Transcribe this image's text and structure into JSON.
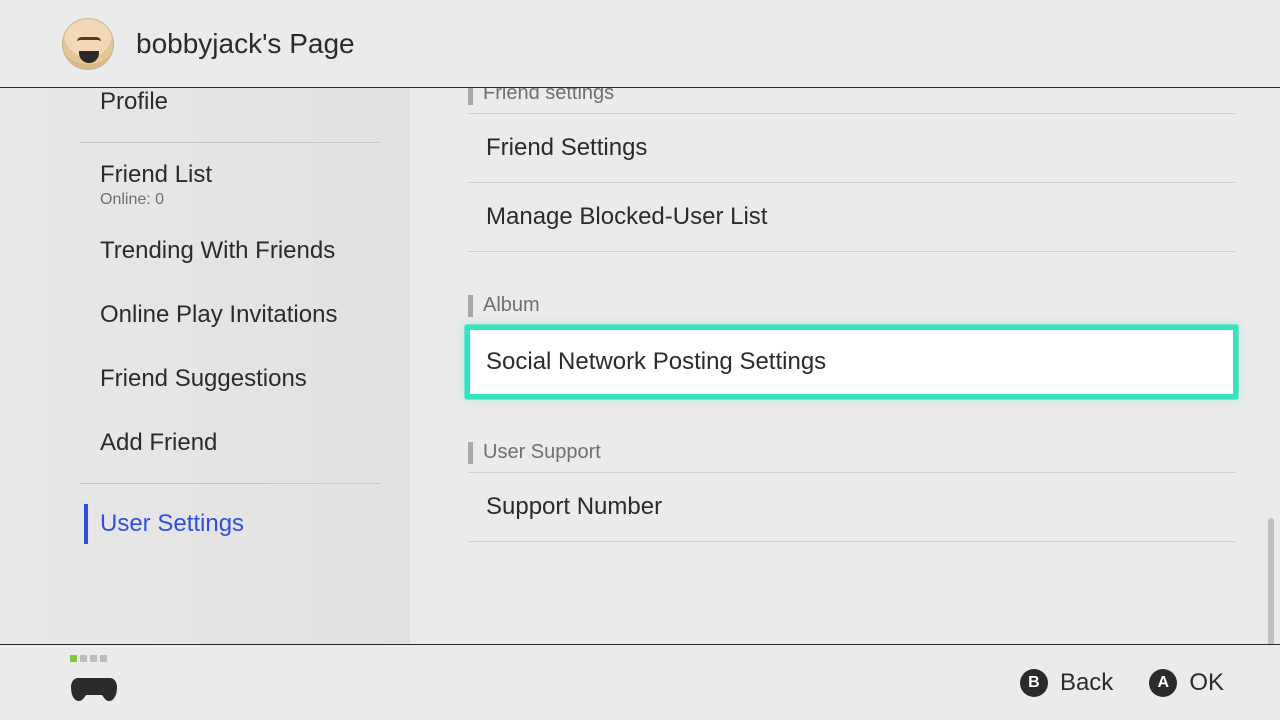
{
  "header": {
    "title": "bobbyjack's Page"
  },
  "sidebar": {
    "items": [
      {
        "label": "Profile"
      },
      {
        "label": "Friend List",
        "sub": "Online: 0"
      },
      {
        "label": "Trending With Friends"
      },
      {
        "label": "Online Play Invitations"
      },
      {
        "label": "Friend Suggestions"
      },
      {
        "label": "Add Friend"
      },
      {
        "label": "User Settings"
      }
    ],
    "active_index": 6
  },
  "main": {
    "groups": [
      {
        "header": "Friend settings",
        "rows": [
          {
            "label": "Friend Settings"
          },
          {
            "label": "Manage Blocked-User List"
          }
        ]
      },
      {
        "header": "Album",
        "rows": [
          {
            "label": "Social Network Posting Settings",
            "selected": true
          }
        ]
      },
      {
        "header": "User Support",
        "rows": [
          {
            "label": "Support Number"
          }
        ]
      }
    ]
  },
  "footer": {
    "hints": [
      {
        "button": "B",
        "label": "Back"
      },
      {
        "button": "A",
        "label": "OK"
      }
    ]
  }
}
